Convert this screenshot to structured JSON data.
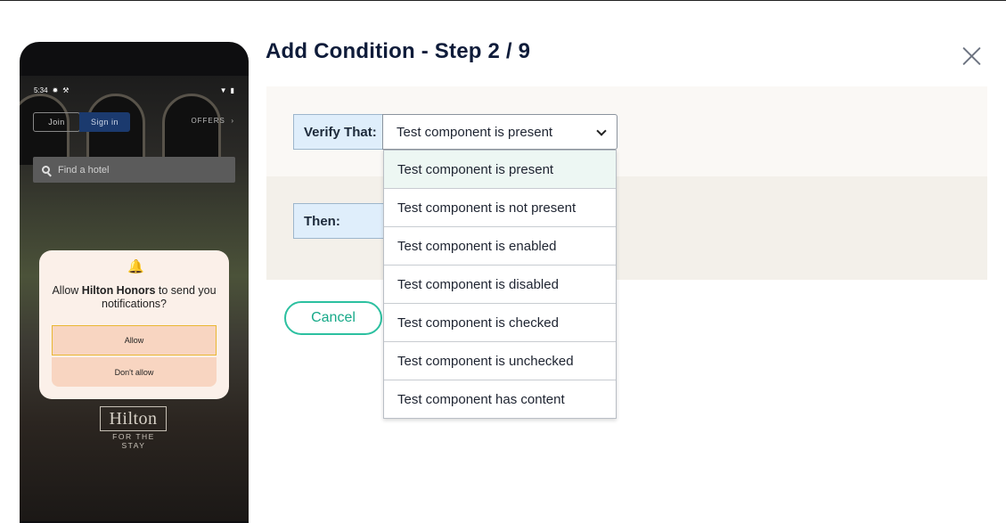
{
  "dialog_title": "Add Condition - Step 2 / 9",
  "verify": {
    "label": "Verify That:",
    "selected": "Test component is present",
    "options": [
      "Test component is present",
      "Test component is not present",
      "Test component is enabled",
      "Test component is disabled",
      "Test component is checked",
      "Test component is unchecked",
      "Test component has content"
    ]
  },
  "then": {
    "label": "Then:",
    "value": ""
  },
  "buttons": {
    "cancel": "Cancel"
  },
  "icons": {
    "close": "close-icon",
    "dropdown": "chevron-down-icon"
  },
  "colors": {
    "accent": "#2cc0a0",
    "title": "#0f1c3a",
    "label_bg": "#dfeefb",
    "selected_option_bg": "#edf7f3"
  },
  "phone": {
    "status_time": "5:34",
    "join": "Join",
    "sign_in": "Sign in",
    "offers": "OFFERS",
    "search_placeholder": "Find a hotel",
    "notification": {
      "prefix": "Allow ",
      "app": "Hilton Honors",
      "suffix": " to send you notifications?",
      "allow": "Allow",
      "deny": "Don't allow"
    },
    "logo": "Hilton",
    "tagline": "FOR THE STAY"
  }
}
